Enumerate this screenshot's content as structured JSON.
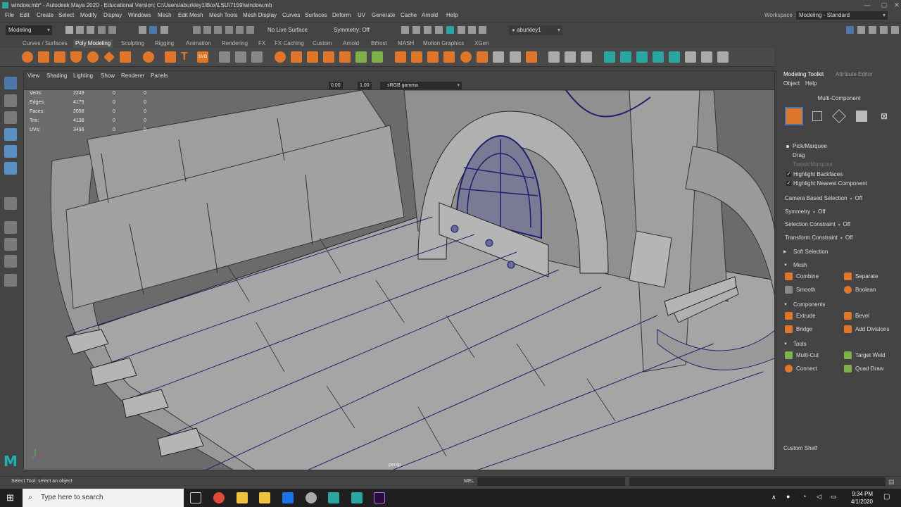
{
  "window": {
    "title": "window.mb* - Autodesk Maya 2020 - Educational Version: C:\\Users\\aburkley1\\Box\\LSU\\7159\\window.mb",
    "minimize": "—",
    "maximize": "▢",
    "close": "✕"
  },
  "menubar": {
    "items": [
      "File",
      "Edit",
      "Create",
      "Select",
      "Modify",
      "Display",
      "Windows",
      "Mesh",
      "Edit Mesh",
      "Mesh Tools",
      "Mesh Display",
      "Curves",
      "Surfaces",
      "Deform",
      "UV",
      "Generate",
      "Cache",
      "Arnold",
      "Help"
    ],
    "workspace_label": "Workspace :",
    "workspace_value": "Modeling - Standard"
  },
  "statusline": {
    "mode": "Modeling",
    "live_surface": "No Live Surface",
    "symmetry": "Symmetry: Off",
    "user": "aburkley1"
  },
  "shelf": {
    "tabs": [
      "Curves / Surfaces",
      "Poly Modeling",
      "Sculpting",
      "Rigging",
      "Animation",
      "Rendering",
      "FX",
      "FX Caching",
      "Custom",
      "Arnold",
      "Bifrost",
      "MASH",
      "Motion Graphics",
      "XGen"
    ],
    "active_tab": "Poly Modeling"
  },
  "viewport": {
    "menu": [
      "View",
      "Shading",
      "Lighting",
      "Show",
      "Renderer",
      "Panels"
    ],
    "value1": "0.00",
    "value2": "1.00",
    "colorspace": "sRGB gamma",
    "camera": "persp",
    "hud": [
      {
        "label": "Verts:",
        "a": "2249",
        "b": "0",
        "c": "0"
      },
      {
        "label": "Edges:",
        "a": "4175",
        "b": "0",
        "c": "0"
      },
      {
        "label": "Faces:",
        "a": "2058",
        "b": "0",
        "c": "0"
      },
      {
        "label": "Tris:",
        "a": "4138",
        "b": "0",
        "c": "0"
      },
      {
        "label": "UVs:",
        "a": "3496",
        "b": "0",
        "c": "0"
      }
    ]
  },
  "toolkit": {
    "tab_active": "Modeling Toolkit",
    "tab_other": "Attribute Editor",
    "menu_object": "Object",
    "menu_help": "Help",
    "mode": "Multi-Component",
    "pick_marquee": "Pick/Marquee",
    "drag": "Drag",
    "tweak_marquee": "Tweak/Marquee",
    "highlight_backfaces": "Highlight Backfaces",
    "highlight_nearest": "Highlight Nearest Component",
    "camera_based_label": "Camera Based Selection",
    "camera_based_value": "Off",
    "symmetry_label": "Symmetry",
    "symmetry_value": "Off",
    "sel_constraint_label": "Selection Constraint",
    "sel_constraint_value": "Off",
    "transform_constraint_label": "Transform Constraint",
    "transform_constraint_value": "Off",
    "soft_selection": "Soft Selection",
    "mesh_header": "Mesh",
    "combine": "Combine",
    "separate": "Separate",
    "smooth": "Smooth",
    "boolean": "Boolean",
    "components_header": "Components",
    "extrude": "Extrude",
    "bevel": "Bevel",
    "bridge": "Bridge",
    "add_divisions": "Add Divisions",
    "tools_header": "Tools",
    "multi_cut": "Multi-Cut",
    "target_weld": "Target Weld",
    "connect": "Connect",
    "quad_draw": "Quad Draw",
    "custom_shelf": "Custom Shelf"
  },
  "helpline": {
    "text": "Select Tool: select an object",
    "mel": "MEL"
  },
  "taskbar": {
    "search_placeholder": "Type here to search",
    "time": "9:34 PM",
    "date": "4/1/2020"
  },
  "colors": {
    "accent": "#2aa6a0",
    "orange": "#e0762a",
    "wire": "#1f1f6b"
  }
}
